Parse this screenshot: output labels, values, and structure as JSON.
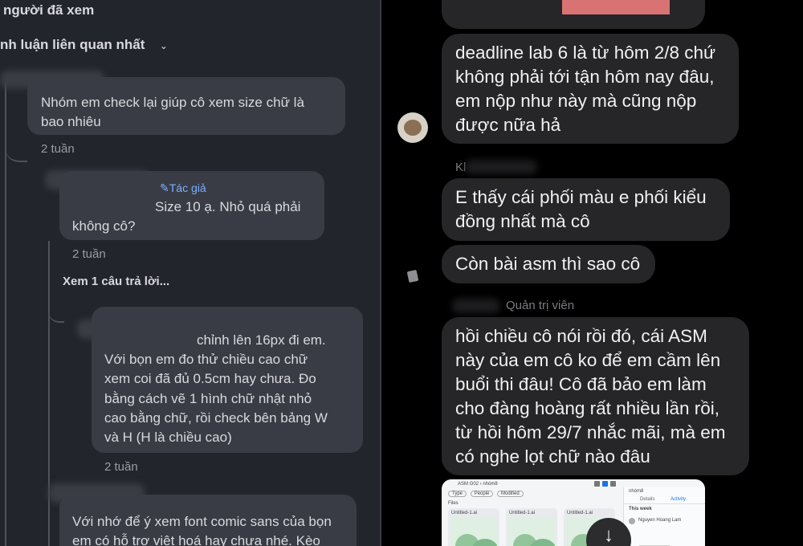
{
  "left": {
    "viewers_text": "người đã xem",
    "sort_label": "nh luận liên quan nhất",
    "comments": [
      {
        "lines": [
          "Nhóm em check lại giúp cô xem size chữ là",
          "bao nhiêu"
        ],
        "time": "2 tuần"
      },
      {
        "author_badge": "Tác giả",
        "lines": [
          "Size 10 ạ. Nhỏ quá phải",
          "không cô?"
        ],
        "time": "2 tuần"
      },
      {
        "lines": [
          "chỉnh lên 16px đi em.",
          "Với bọn em đo thử chiều cao chữ",
          "xem coi đã đủ 0.5cm hay chưa. Đo",
          "bằng cách vẽ 1 hình chữ nhật nhỏ",
          "cao bằng chữ, rồi check bên bảng W",
          "và H (H là chiều cao)"
        ],
        "time": "2 tuần"
      },
      {
        "lines": [
          "Với nhớ để ý xem font comic sans của bọn",
          "em có hỗ trợ việt hoá hay chưa nhé. Kèo"
        ]
      }
    ],
    "view_replies": "Xem 1 câu trả lời..."
  },
  "right": {
    "messages": [
      {
        "lines": [
          "deadline lab 6 là từ hôm 2/8 chứ",
          "không phải tới tận hôm nay đâu,",
          "em nộp như này mà cũng nộp",
          "được nữa hả"
        ]
      },
      {
        "sender_initial": "Kl",
        "lines": [
          "E thấy cái phối màu e phối kiểu",
          "đồng nhất mà cô"
        ]
      },
      {
        "lines": [
          "Còn bài asm thì sao cô"
        ]
      },
      {
        "sender_role": "Quản trị viên",
        "lines": [
          "hồi chiều cô nói rồi đó, cái ASM",
          "này của em cô ko để em cầm lên",
          "buổi thi đâu! Cô đã bảo em làm",
          "cho đàng hoàng rất nhiều lần rồi,",
          "từ hồi hôm 29/7 nhắc mãi, mà em",
          "có nghe lọt chữ nào đâu"
        ]
      }
    ],
    "screenshot": {
      "path_a": "ASM G02",
      "path_b": "nhóm8",
      "tab_details": "Details",
      "tab_activity": "Activity",
      "this_week": "This week",
      "file_name": "Untitled-1.ai",
      "filter_a": "Type",
      "filter_b": "People",
      "filter_c": "Modified",
      "files_label": "Files",
      "activity_user": "Nguyen Hoang Lam"
    }
  }
}
